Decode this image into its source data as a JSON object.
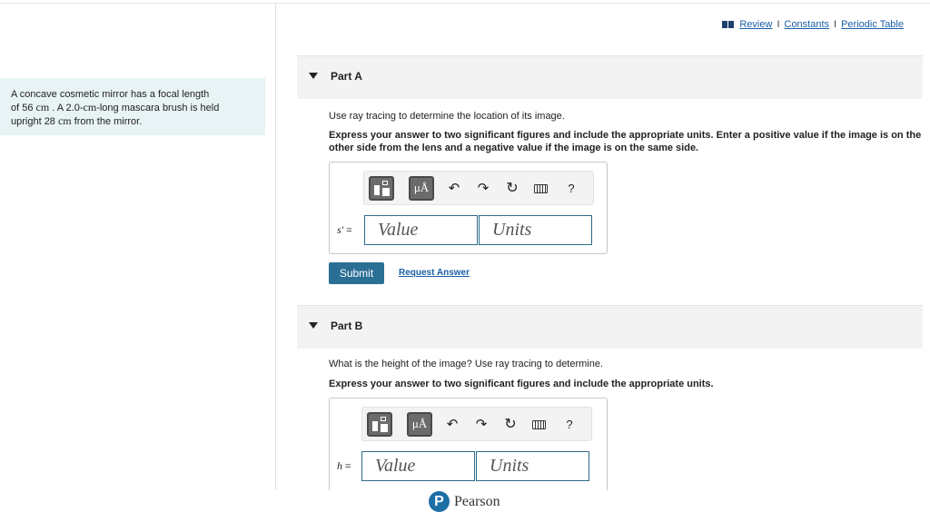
{
  "problem": {
    "p1": "A concave cosmetic mirror has a focal length",
    "p2a": "of 56 ",
    "p2unit": "cm",
    "p2b": " . A 2.0-",
    "p2unit2": "cm",
    "p2c": "-long mascara brush is held",
    "p3a": "upright 28 ",
    "p3unit": "cm",
    "p3b": " from the mirror."
  },
  "toplinks": {
    "review": "Review",
    "sep1": "I",
    "constants": "Constants",
    "sep2": "I",
    "periodic": "Periodic Table"
  },
  "partA": {
    "title": "Part A",
    "question": "Use ray tracing to determine the location of its image.",
    "instruction": "Express your answer to two significant figures and include the appropriate units. Enter a positive value if the image is on the other side from the lens and a negative value if the image is on the same side.",
    "var": "s′",
    "eq": "=",
    "value_placeholder": "Value",
    "units_placeholder": "Units",
    "submit": "Submit",
    "request": "Request Answer"
  },
  "partB": {
    "title": "Part B",
    "question": "What is the height of the image? Use ray tracing to determine.",
    "instruction": "Express your answer to two significant figures and include the appropriate units.",
    "var": "h",
    "eq": "=",
    "value_placeholder": "Value",
    "units_placeholder": "Units"
  },
  "toolbar": {
    "units_label": "μÅ",
    "undo": "↶",
    "redo": "↷",
    "reset": "↻",
    "help": "?"
  },
  "footer": {
    "logo": "P",
    "brand": "Pearson"
  }
}
